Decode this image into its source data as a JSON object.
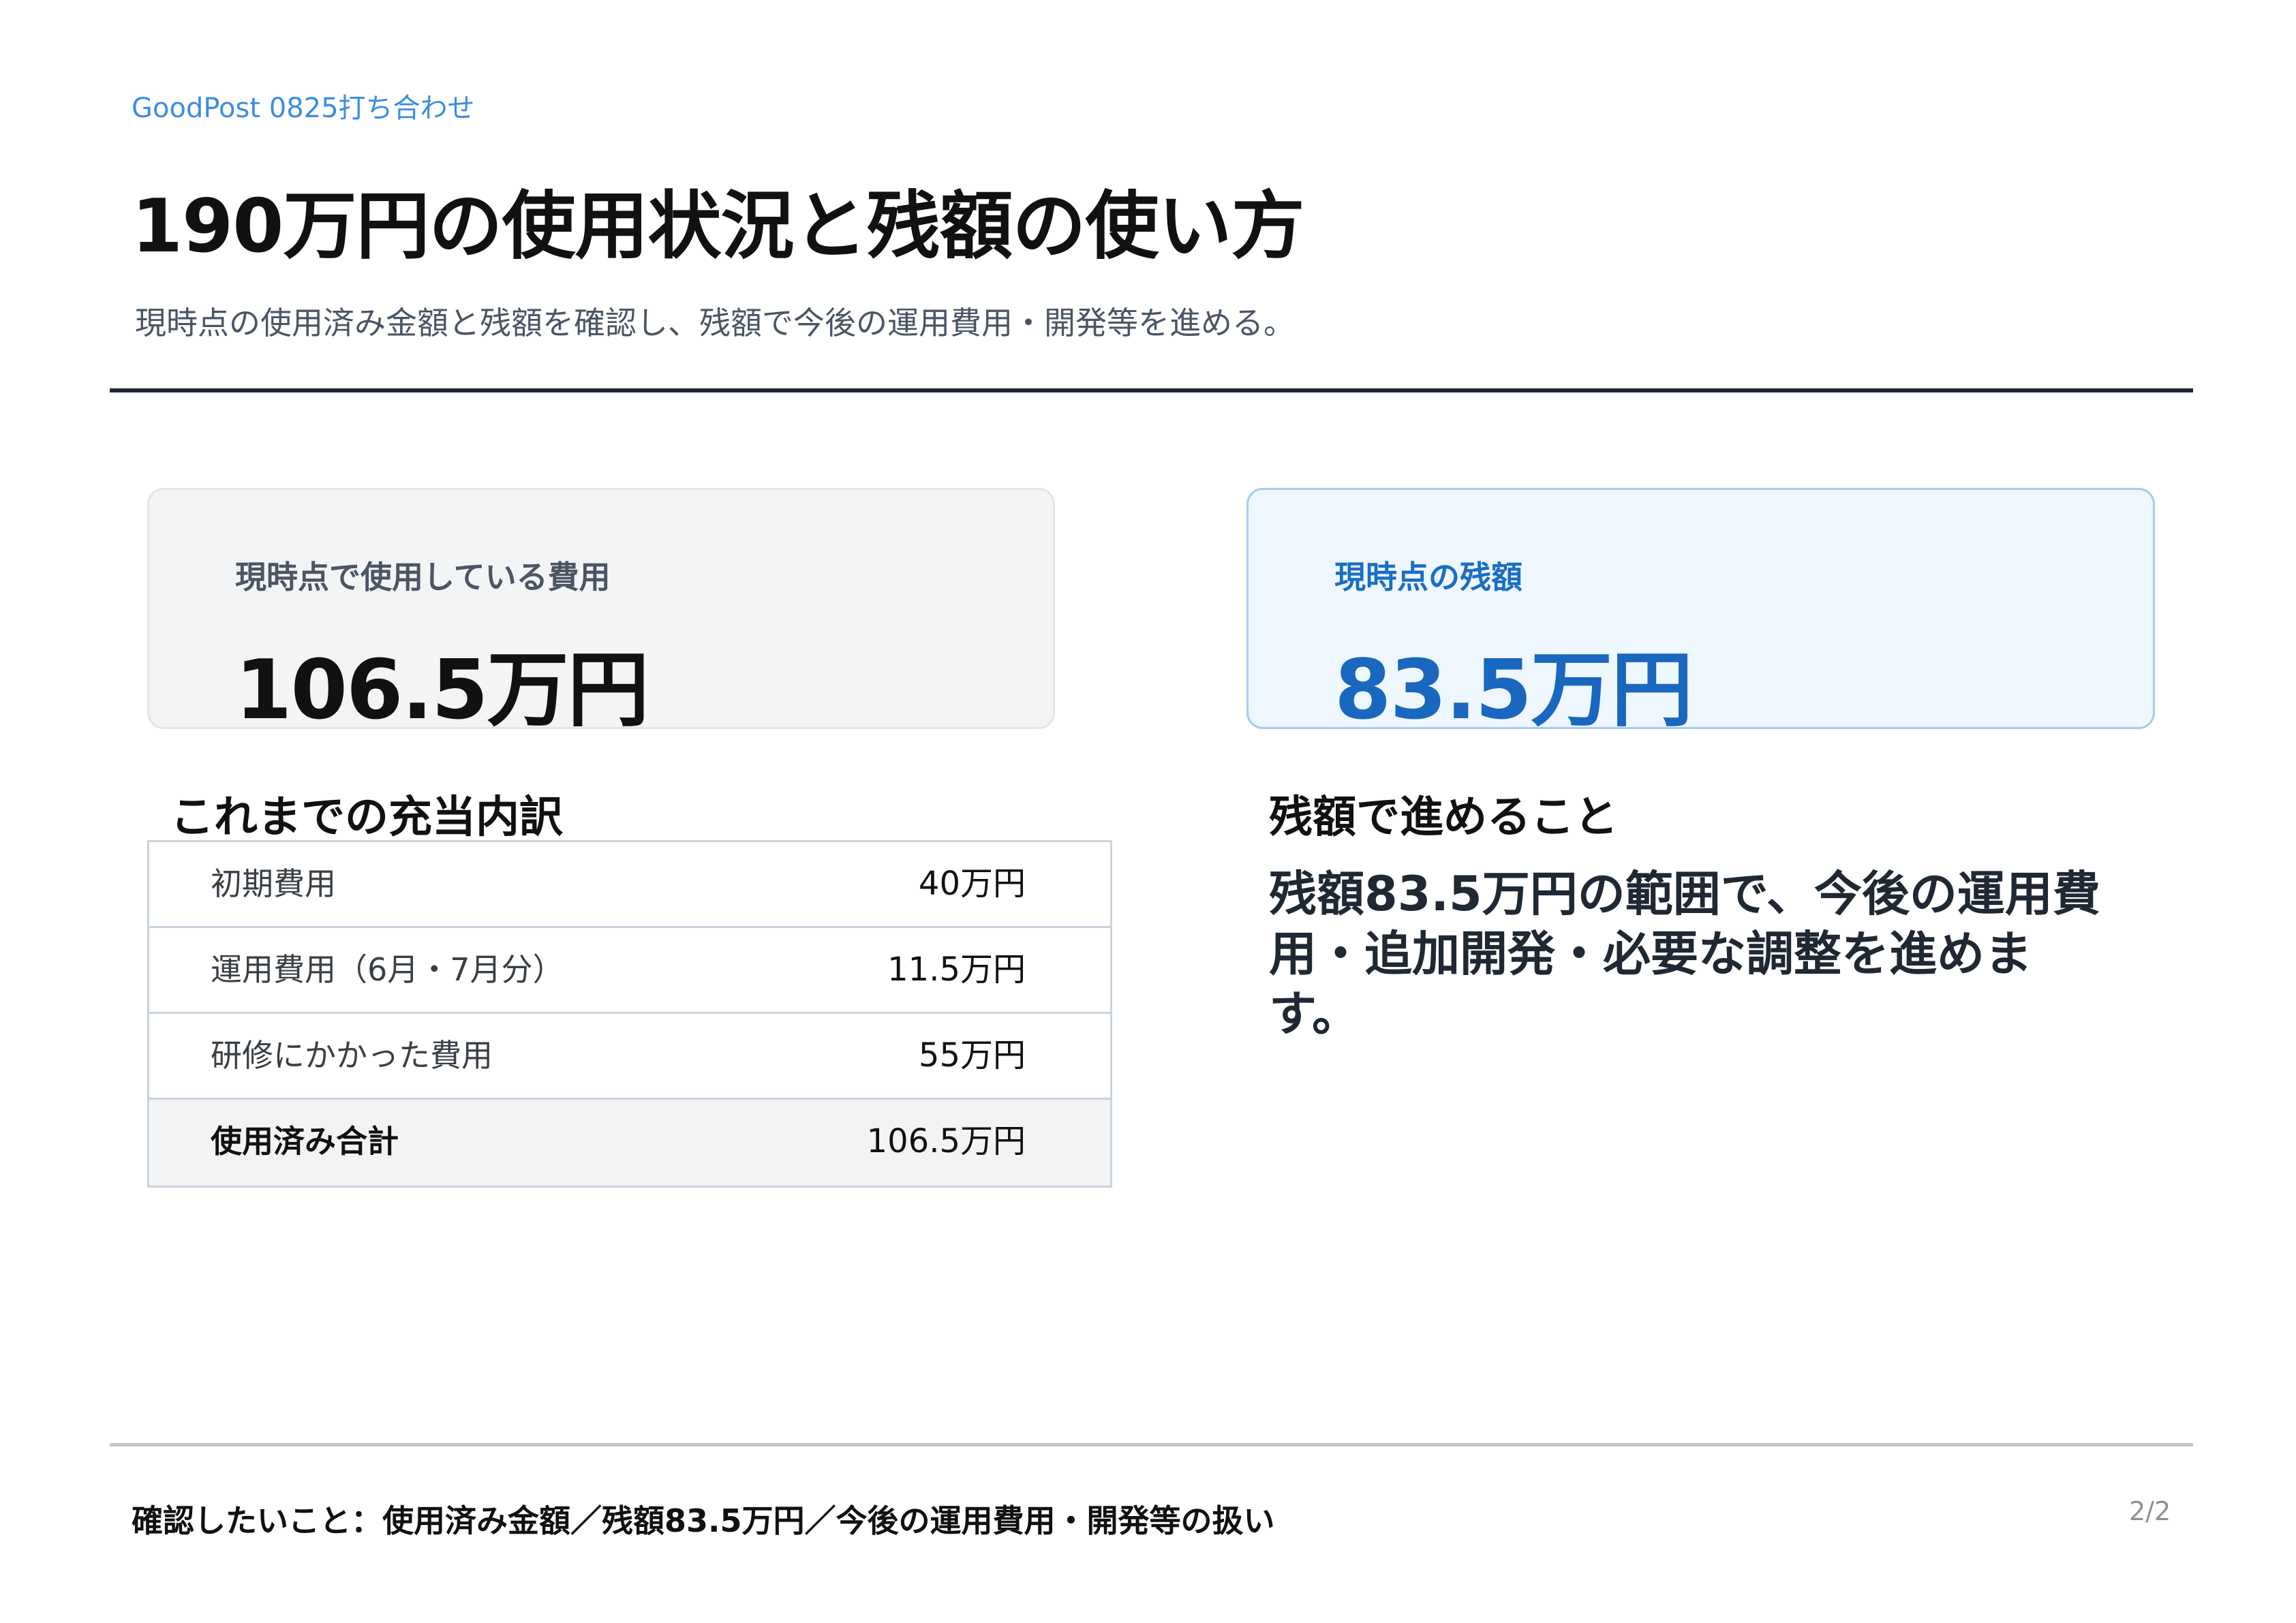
{
  "header": {
    "kicker": "GoodPost 0825打ち合わせ",
    "title": "190万円の使用状況と残額の使い方",
    "subtitle": "現時点の使用済み金額と残額を確認し、残額で今後の運用費用・開発等を進める。"
  },
  "cards": {
    "used": {
      "label": "現時点で使用している費用",
      "value": "106.5万円"
    },
    "remaining": {
      "label": "現時点の残額",
      "value": "83.5万円"
    }
  },
  "breakdown": {
    "heading": "これまでの充当内訳",
    "rows": [
      {
        "label": "初期費用",
        "value": "40万円"
      },
      {
        "label": "運用費用（6月・7月分）",
        "value": "11.5万円"
      },
      {
        "label": "研修にかかった費用",
        "value": "55万円"
      },
      {
        "label": "使用済み合計",
        "value": "106.5万円"
      }
    ]
  },
  "plan": {
    "heading": "残額で進めること",
    "body": "残額83.5万円の範囲で、今後の運用費用・追加開発・必要な調整を進めます。"
  },
  "footer": {
    "note": "確認したいこと：使用済み金額／残額83.5万円／今後の運用費用・開発等の扱い",
    "page": "2/2"
  },
  "colors": {
    "accent": "#1967bf",
    "kicker": "#3b8ee0",
    "remaining_card_bg": "#eef6fe",
    "used_card_bg": "#f3f4f6"
  }
}
